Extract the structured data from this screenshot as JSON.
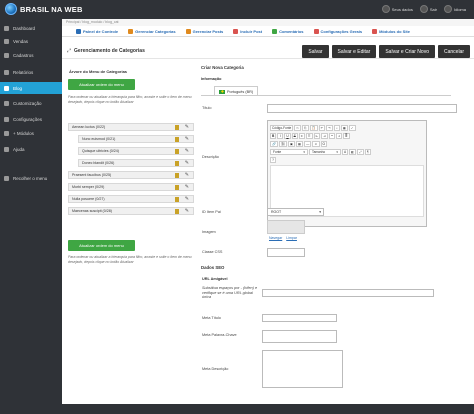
{
  "topbar": {
    "brand": "BRASIL NA WEB",
    "user_items": [
      {
        "label": "Seus dados"
      },
      {
        "label": "Sair"
      },
      {
        "label": "Idioma"
      }
    ]
  },
  "sidebar": {
    "items": [
      {
        "label": "Dashboard",
        "active": false
      },
      {
        "label": "Vendas",
        "active": false
      },
      {
        "label": "Cadastros",
        "active": false
      },
      {
        "label": "Relatórios",
        "active": false
      },
      {
        "label": "Blog",
        "active": true
      },
      {
        "label": "Customização",
        "active": false
      },
      {
        "label": "Configurações",
        "active": false
      },
      {
        "label": "+ Módulos",
        "active": false
      },
      {
        "label": "Ajuda",
        "active": false
      },
      {
        "label": "Recolher o menu",
        "active": false
      }
    ]
  },
  "breadcrumb": "Principal / blog_modulo / blog_cat",
  "modnav": {
    "items": [
      {
        "label": "Painel de Controle",
        "color": "#2a6db5"
      },
      {
        "label": "Gerenciar Categorias",
        "color": "#e08a1e"
      },
      {
        "label": "Gerenciar Posts",
        "color": "#e08a1e"
      },
      {
        "label": "Incluir Post",
        "color": "#d9534f"
      },
      {
        "label": "Comentários",
        "color": "#3fa643"
      },
      {
        "label": "Configurações Gerais",
        "color": "#d9534f"
      },
      {
        "label": "Módulos do Site",
        "color": "#d9534f"
      }
    ]
  },
  "page": {
    "title": "Gerenciamento de Categorias",
    "buttons": {
      "save": "Salvar",
      "save_edit": "Salvar e Editar",
      "save_new": "Salvar e Criar Novo",
      "cancel": "Cancelar"
    }
  },
  "tree": {
    "title": "Árvore do Menu de Categorias",
    "update_order": "Atualizar ordem do menu",
    "help_text": "Para ordenar ou atualizar a hierarquia para filho, arraste e solte o item de menu desejado, depois clique no botão Atualizar",
    "nodes": [
      {
        "label": "Aenean luctus (0/22)"
      },
      {
        "label": "Nunc euismod (0/21)"
      },
      {
        "label": "Quisque ultricies (0/24)"
      },
      {
        "label": "Donec blandit (0/26)"
      },
      {
        "label": "Praesent faucibus (0/25)"
      },
      {
        "label": "Morbi semper (0/29)"
      },
      {
        "label": "Nulla posuere (0/27)"
      },
      {
        "label": "Maecenas suscipit (0/28)"
      }
    ]
  },
  "form": {
    "title": "Criar Nova Categoria",
    "info_label": "Informação",
    "language_tab": "Português (BR)",
    "fields": {
      "title_label": "Título",
      "description_label": "Descrição",
      "parent_label": "ID Item Pai",
      "parent_value": "ROOT",
      "image_label": "Imagem",
      "image_browse": "Navegar",
      "image_clear": "Limpar",
      "css_label": "Classe CSS"
    },
    "editor": {
      "source_button": "Código-Fonte",
      "font_select": "Fonte",
      "size_select": "Tamanho"
    },
    "seo": {
      "title": "Dados SEO",
      "url_title": "URL Amigável",
      "url_help": "Substitua espaços por - (hífen) e verifique se é uma URL global única",
      "meta_title": "Meta Título",
      "meta_keywords": "Meta Palavra-Chave",
      "meta_description": "Meta Descrição"
    }
  }
}
